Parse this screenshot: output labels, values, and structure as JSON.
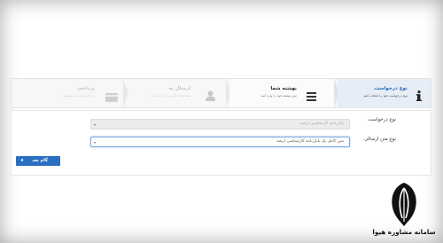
{
  "steps": [
    {
      "title": "نوع درخواست",
      "subtitle": "نوع درخواست خود را انتخاب کنید",
      "icon": "info-icon",
      "state": "active"
    },
    {
      "title": "نوشته شما",
      "subtitle": "متن نوشته خود را وارد کنید",
      "icon": "list-icon",
      "state": "next"
    },
    {
      "title": "ارسال به",
      "subtitle": "مشخصات گیرنده را وارد کنید",
      "icon": "user-icon",
      "state": "disabled"
    },
    {
      "title": "پرداخت",
      "subtitle": "پرداخت هزینه درخواست",
      "icon": "credit-card-icon",
      "state": "disabled"
    }
  ],
  "form": {
    "request_type_label": "نوع درخواست",
    "request_type_value": "پایان‌نامه کارشناسی ارشد",
    "text_type_label": "نوع متن ارسالی",
    "text_type_value": "متن کامل یک پایان‌نامه کارشناسی ارشد"
  },
  "next_button_label": "گام بعد",
  "watermark": "سامانه مشاوره هپوا",
  "colors": {
    "accent": "#2b6fc0",
    "active_step_bg": "#e6edf6",
    "active_step_title": "#2a6db5"
  }
}
